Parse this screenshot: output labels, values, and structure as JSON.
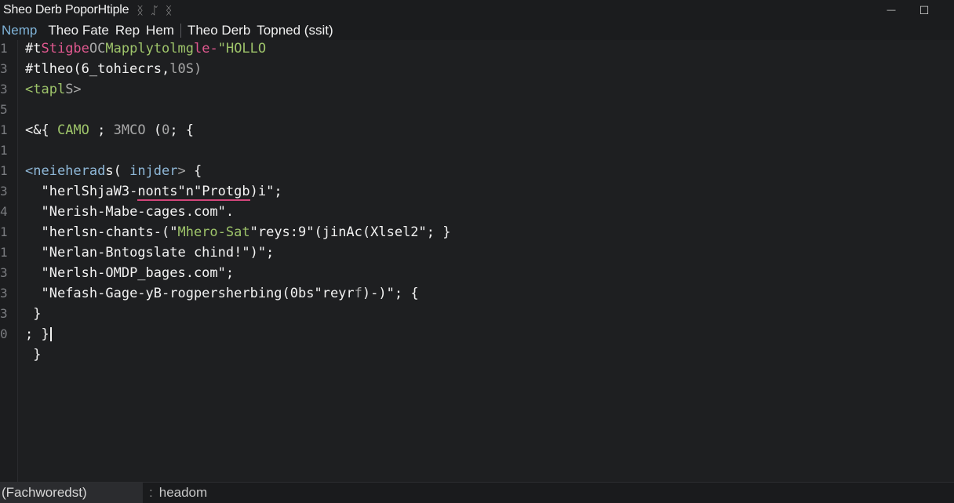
{
  "window": {
    "title": "Sheo Derb PoporHtiple",
    "title_glyphs": "ᛝ ᛢ ᛝ",
    "minimize_glyph": "—",
    "maximize_glyph": "☐"
  },
  "menu": {
    "items": [
      "Nemp",
      "Theo Fate",
      "Rep",
      "Hem",
      "Theo Derb",
      "Topned (ssit)"
    ]
  },
  "gutter": {
    "line_numbers": [
      "1",
      "3",
      "3",
      "5",
      "1",
      "1",
      "1",
      "3",
      "4",
      "1",
      "1",
      "3",
      "3",
      "3",
      "0"
    ]
  },
  "code": {
    "lines": [
      {
        "indent": "",
        "parts": [
          {
            "t": "#t"
          },
          {
            "t": "Stigbe",
            "c": "pink"
          },
          {
            "t": "OC",
            "c": "gray"
          },
          {
            "t": "Mapply",
            "c": "green"
          },
          {
            "t": "tolmg",
            "c": "green"
          },
          {
            "t": "le-",
            "c": "pink"
          },
          {
            "t": "\"HOLLO",
            "c": "green"
          }
        ]
      },
      {
        "indent": "",
        "parts": [
          {
            "t": "#tlheo(6_tohiecrs,"
          },
          {
            "t": "l0S)",
            "c": "gray"
          }
        ]
      },
      {
        "indent": "",
        "parts": [
          {
            "t": "<tapl",
            "c": "green"
          },
          {
            "t": "S>",
            "c": "gray"
          }
        ]
      },
      {
        "indent": "",
        "parts": []
      },
      {
        "indent": "",
        "parts": [
          {
            "t": "<&{ "
          },
          {
            "t": "CAMO",
            "c": "green"
          },
          {
            "t": " ; "
          },
          {
            "t": "3MCO",
            "c": "gray"
          },
          {
            "t": " ("
          },
          {
            "t": "0",
            "c": "gray"
          },
          {
            "t": "; {"
          }
        ]
      },
      {
        "indent": "",
        "parts": []
      },
      {
        "indent": "",
        "parts": [
          {
            "t": "<neieherad",
            "c": "blue"
          },
          {
            "t": "s( "
          },
          {
            "t": "injder",
            "c": "blue"
          },
          {
            "t": ">",
            "c": "gray"
          },
          {
            "t": " {"
          }
        ]
      },
      {
        "indent": "  ",
        "parts": [
          {
            "t": "\"herlShjaW3-"
          },
          {
            "t": "nonts\"n\"Protgb",
            "c": "ul"
          },
          {
            "t": ")i\";"
          }
        ]
      },
      {
        "indent": "  ",
        "parts": [
          {
            "t": "\"Nerish-Mabe-cages.com\"."
          }
        ]
      },
      {
        "indent": "  ",
        "parts": [
          {
            "t": "\"herlsn-chants-(\""
          },
          {
            "t": "Mhero-Sat",
            "c": "green"
          },
          {
            "t": "\"reys:9\"(jinAc(Xlsel2\"; }"
          }
        ]
      },
      {
        "indent": "  ",
        "parts": [
          {
            "t": "\"Nerlan-Bntogslate chind!\")\";"
          }
        ]
      },
      {
        "indent": "  ",
        "parts": [
          {
            "t": "\"Nerlsh-OMDP_bages.com\";"
          }
        ]
      },
      {
        "indent": "  ",
        "parts": [
          {
            "t": "\"Nefash-Gage-yB-rogpersherbing(0bs\"reyr"
          },
          {
            "t": "f",
            "c": "gray"
          },
          {
            "t": ")-)\"; {"
          }
        ]
      },
      {
        "indent": " ",
        "parts": [
          {
            "t": "}"
          }
        ]
      },
      {
        "indent": "",
        "parts": [
          {
            "t": "; }"
          },
          {
            "t": "",
            "c": "cursor"
          }
        ]
      },
      {
        "indent": " ",
        "parts": [
          {
            "t": "}"
          }
        ]
      }
    ]
  },
  "status": {
    "mode": "(Fachworedst)",
    "separator": ":",
    "context": "headom"
  },
  "colors": {
    "background": "#1e1f21",
    "pink": "#e0588f",
    "green": "#9ec46a",
    "blue": "#8fb8d8",
    "accent": "#7fb3d8"
  }
}
